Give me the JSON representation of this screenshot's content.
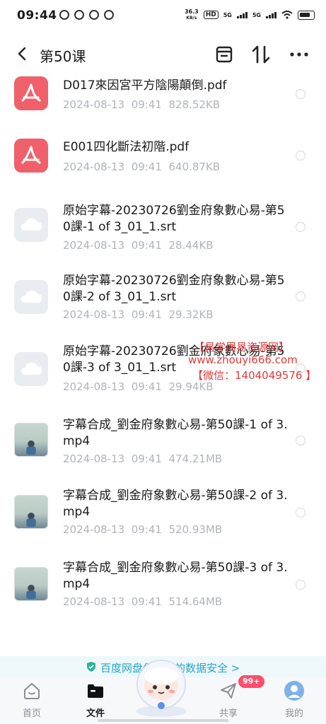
{
  "status": {
    "time": "09:44",
    "net_speed_value": "36.3",
    "net_speed_unit": "KB/s",
    "hd": "HD",
    "sim1": "5G",
    "sim2": "5G"
  },
  "header": {
    "title": "第50课",
    "icons": [
      "back-arrow-icon",
      "archive-icon",
      "sort-icon",
      "more-icon"
    ]
  },
  "files": [
    {
      "name": "D017來因宮平方陰陽顛倒.pdf",
      "date": "2024-08-13  09:41",
      "size": "828.52KB",
      "type": "pdf"
    },
    {
      "name": "E001四化斷法初階.pdf",
      "date": "2024-08-13  09:41",
      "size": "640.87KB",
      "type": "pdf"
    },
    {
      "name": "原始字幕-20230726劉金府象數心易-第50課-1 of 3_01_1.srt",
      "date": "2024-08-13  09:41",
      "size": "28.44KB",
      "type": "srt"
    },
    {
      "name": "原始字幕-20230726劉金府象數心易-第50課-2 of 3_01_1.srt",
      "date": "2024-08-13  09:41",
      "size": "29.32KB",
      "type": "srt"
    },
    {
      "name": "原始字幕-20230726劉金府象數心易-第50課-3 of 3_01_1.srt",
      "date": "2024-08-13  09:41",
      "size": "29.94KB",
      "type": "srt"
    },
    {
      "name": "字幕合成_劉金府象數心易-第50課-1 of 3.mp4",
      "date": "2024-08-13  09:41",
      "size": "474.21MB",
      "type": "video"
    },
    {
      "name": "字幕合成_劉金府象數心易-第50課-2 of 3.mp4",
      "date": "2024-08-13  09:41",
      "size": "520.93MB",
      "type": "video"
    },
    {
      "name": "字幕合成_劉金府象數心易-第50課-3 of 3.mp4",
      "date": "2024-08-13  09:41",
      "size": "514.64MB",
      "type": "video"
    }
  ],
  "watermark": {
    "line1": "【易学周易资源网】",
    "line2": "www.zhouyi666.com",
    "line3": "【微信：1404049576  】"
  },
  "banner": {
    "text": "百度网盘保护你的数据安全 >"
  },
  "tabs": [
    {
      "label": "首页",
      "icon": "home-face-icon",
      "active": false
    },
    {
      "label": "文件",
      "icon": "folder-icon",
      "active": true
    },
    {
      "label": "共享",
      "icon": "share-paper-plane-icon",
      "active": false
    },
    {
      "label": "我的",
      "icon": "avatar-icon",
      "active": false
    }
  ],
  "share_badge": "99+",
  "colors": {
    "pdf": "#f0606a",
    "accent": "#26a6c7",
    "badge": "#ff4d6a",
    "watermark": "#e23a3a"
  }
}
